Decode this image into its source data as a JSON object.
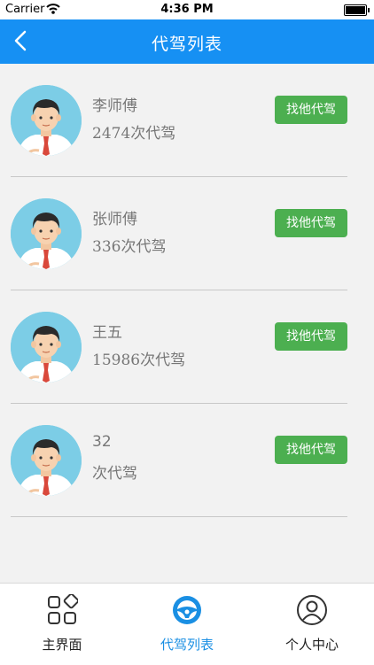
{
  "status_bar": {
    "carrier": "Carrier",
    "time": "4:36 PM"
  },
  "nav": {
    "title": "代驾列表"
  },
  "drivers": [
    {
      "name": "李师傅",
      "count": "2474次代驾",
      "button": "找他代驾"
    },
    {
      "name": "张师傅",
      "count": "336次代驾",
      "button": "找他代驾"
    },
    {
      "name": "王五",
      "count": "15986次代驾",
      "button": "找他代驾"
    },
    {
      "name": "32",
      "count": "次代驾",
      "button": "找他代驾"
    }
  ],
  "tabs": [
    {
      "label": "主界面",
      "icon": "grid-icon",
      "active": false
    },
    {
      "label": "代驾列表",
      "icon": "steering-wheel-icon",
      "active": true
    },
    {
      "label": "个人中心",
      "icon": "user-icon",
      "active": false
    }
  ],
  "colors": {
    "nav_bg": "#1690f3",
    "button_bg": "#4caf50",
    "active_tab": "#1a8fe3"
  }
}
